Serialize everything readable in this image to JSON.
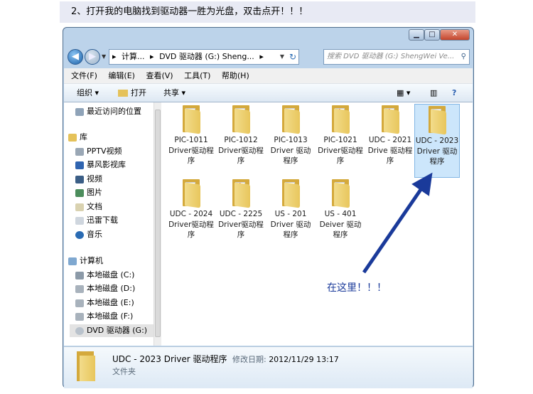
{
  "instruction": "2、打开我的电脑找到驱动器一胜为光盘，双击点开！！！",
  "window": {
    "controls": {
      "minimize": "▁",
      "maximize": "□",
      "close": "✕"
    },
    "address": {
      "crumb_sep": "▸",
      "crumb1": "计算...",
      "crumb2": "DVD 驱动器 (G:) Sheng...",
      "arrow": "▸"
    },
    "search_placeholder": "搜索 DVD 驱动器 (G:) ShengWei Ve...",
    "menu": [
      "文件(F)",
      "编辑(E)",
      "查看(V)",
      "工具(T)",
      "帮助(H)"
    ],
    "toolbar": {
      "organize": "组织 ▾",
      "open": "打开",
      "share": "共享 ▾"
    },
    "nav": {
      "recent": "最近访问的位置",
      "library": "库",
      "lib_items": [
        "PPTV视频",
        "暴风影视库",
        "视频",
        "图片",
        "文档",
        "迅雷下载",
        "音乐"
      ],
      "computer": "计算机",
      "drives": [
        "本地磁盘 (C:)",
        "本地磁盘 (D:)",
        "本地磁盘 (E:)",
        "本地磁盘 (F:)",
        "DVD 驱动器 (G:)"
      ]
    },
    "files": [
      {
        "label": "PIC-1011 Driver驱动程序"
      },
      {
        "label": "PIC-1012 Driver驱动程序"
      },
      {
        "label": "PIC-1013 Driver 驱动程序"
      },
      {
        "label": "PIC-1021 Driver驱动程序"
      },
      {
        "label": "UDC - 2021 Drive 驱动程序"
      },
      {
        "label": "UDC - 2023 Driver 驱动程序"
      },
      {
        "label": "UDC - 2024 Driver驱动程序"
      },
      {
        "label": "UDC - 2225 Driver驱动程序"
      },
      {
        "label": "US - 201 Driver 驱动程序"
      },
      {
        "label": "US - 401 Deiver 驱动程序"
      }
    ],
    "details": {
      "name": "UDC - 2023 Driver 驱动程序",
      "date_label": "修改日期:",
      "date": "2012/11/29 13:17",
      "type": "文件夹"
    }
  },
  "annotation": "在这里！！！",
  "colors": {
    "accent": "#1a3a9a",
    "folder": "#e8c65c",
    "selection": "#cce6fb"
  }
}
